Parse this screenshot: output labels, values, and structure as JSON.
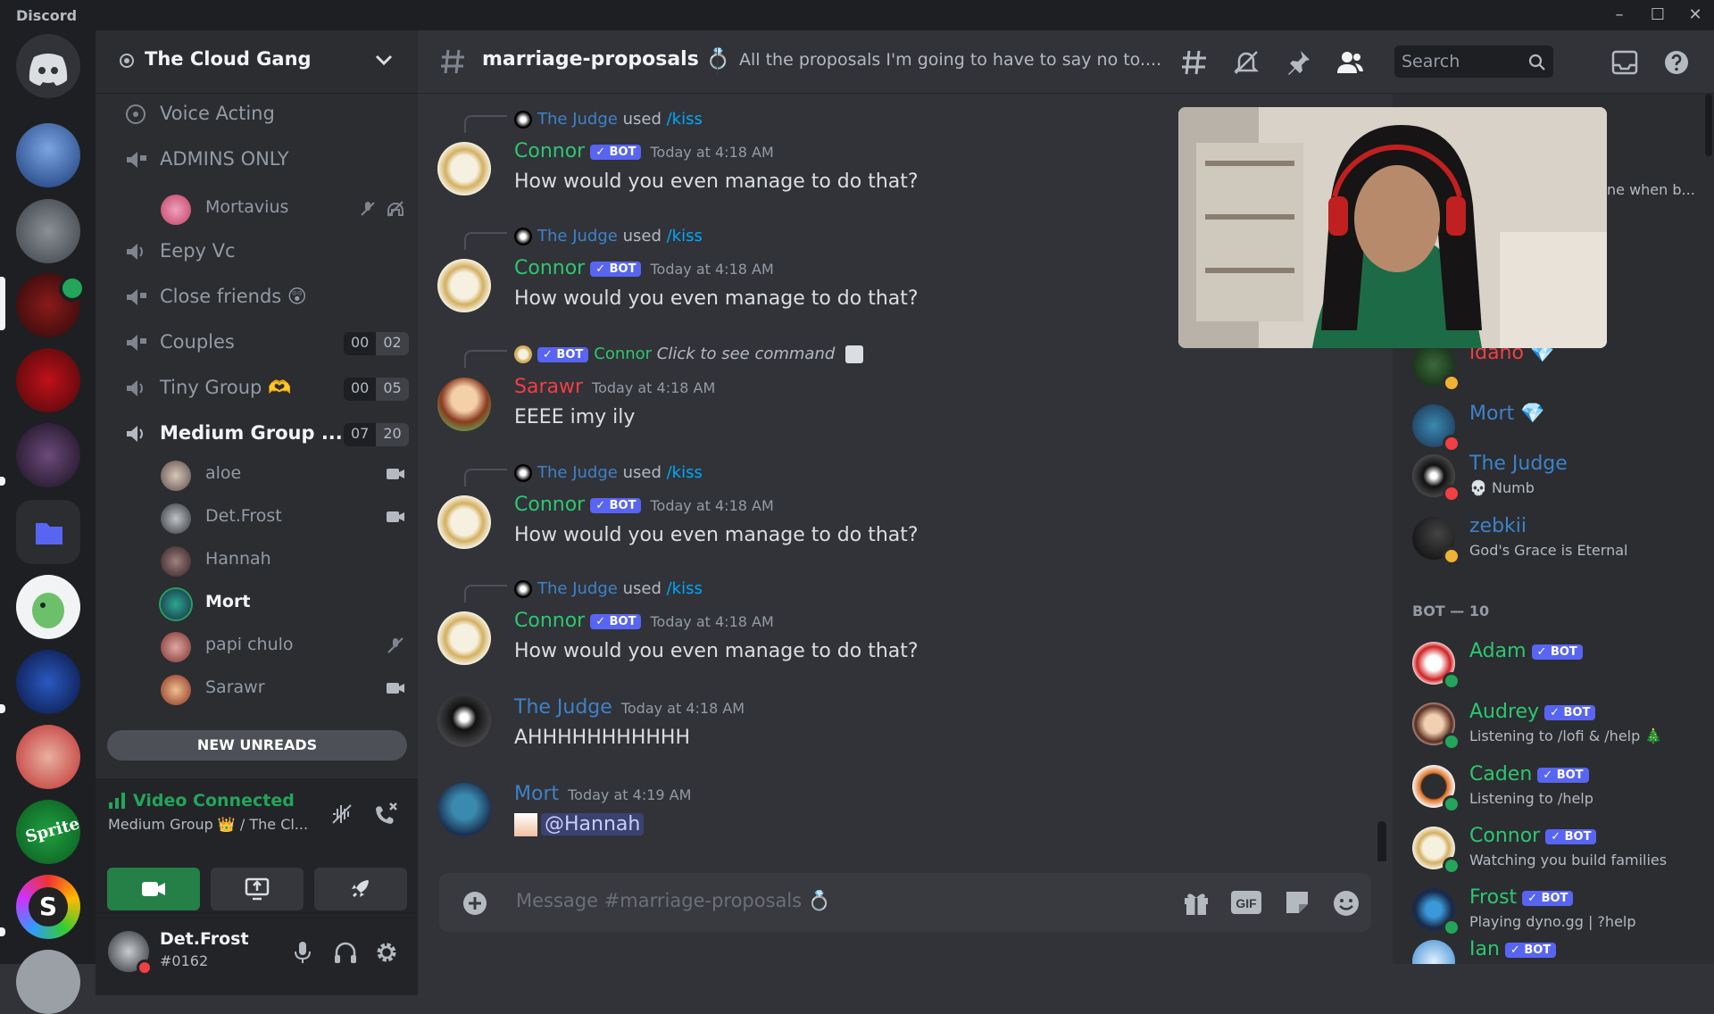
{
  "app": {
    "name": "Discord"
  },
  "colors": {
    "bot_green": "#2dc770",
    "blurple": "#5865f2",
    "judge_blue": "#3e82c9",
    "sarawr_red": "#f23f43",
    "online": "#23a55a",
    "dnd": "#f23f43",
    "idle": "#f0b232"
  },
  "server": {
    "name": "The Cloud Gang"
  },
  "channels": [
    {
      "name": "Voice Acting"
    },
    {
      "name": "ADMINS ONLY"
    },
    {
      "name": "Eepy Vc"
    },
    {
      "name": "Close friends 😲"
    },
    {
      "name": "Couples",
      "count_a": "00",
      "count_b": "02"
    },
    {
      "name": "Tiny Group 🫶",
      "count_a": "00",
      "count_b": "05"
    },
    {
      "name": "Medium Group ...",
      "count_a": "07",
      "count_b": "20"
    }
  ],
  "admins_users": [
    {
      "name": "Mortavius"
    }
  ],
  "voice_users": [
    {
      "name": "aloe"
    },
    {
      "name": "Det.Frost"
    },
    {
      "name": "Hannah"
    },
    {
      "name": "Mort"
    },
    {
      "name": "papi chulo"
    },
    {
      "name": "Sarawr"
    }
  ],
  "new_unreads": "NEW UNREADS",
  "voice": {
    "status": "Video Connected",
    "location": "Medium Group 👑 / The Cl..."
  },
  "user": {
    "name": "Det.Frost",
    "tag": "#0162"
  },
  "channel": {
    "name": "marriage-proposals 💍",
    "topic": "All the proposals I'm going to have to say no to....",
    "placeholder": "Message #marriage-proposals 💍"
  },
  "search": {
    "placeholder": "Search"
  },
  "bot_tag": "✓ BOT",
  "messages": [
    {
      "reply_user": "The Judge",
      "reply_text": "used",
      "command": "/kiss",
      "author": "Connor",
      "time": "Today at 4:18 AM",
      "text": "How would you even manage to do that?"
    },
    {
      "reply_user": "The Judge",
      "reply_text": "used",
      "command": "/kiss",
      "author": "Connor",
      "time": "Today at 4:18 AM",
      "text": "How would you even manage to do that?"
    },
    {
      "reply_user": "Connor",
      "reply_text": "Click to see command",
      "author": "Sarawr",
      "time": "Today at 4:18 AM",
      "text": "EEEE imy ily"
    },
    {
      "reply_user": "The Judge",
      "reply_text": "used",
      "command": "/kiss",
      "author": "Connor",
      "time": "Today at 4:18 AM",
      "text": "How would you even manage to do that?"
    },
    {
      "reply_user": "The Judge",
      "reply_text": "used",
      "command": "/kiss",
      "author": "Connor",
      "time": "Today at 4:18 AM",
      "text": "How would you even manage to do that?"
    },
    {
      "author": "The Judge",
      "time": "Today at 4:18 AM",
      "text": "AHHHHHHHHHHH"
    },
    {
      "author": "Mort",
      "time": "Today at 4:19 AM",
      "text": "@Hannah"
    }
  ],
  "members": {
    "partial_text": "ne when b...",
    "online": [
      {
        "name": "idaho 💎"
      },
      {
        "name": "Mort 💎"
      },
      {
        "name": "The Judge",
        "sub": "💀 Numb"
      },
      {
        "name": "zebkii",
        "sub": "God's Grace is Eternal"
      }
    ],
    "bot_header": "BOT — 10",
    "bots": [
      {
        "name": "Adam"
      },
      {
        "name": "Audrey",
        "sub": "Listening to /lofi & /help 🎄"
      },
      {
        "name": "Caden",
        "sub": "Listening to /help"
      },
      {
        "name": "Connor",
        "sub": "Watching you build families"
      },
      {
        "name": "Frost",
        "sub": "Playing dyno.gg | ?help"
      },
      {
        "name": "Ian"
      }
    ]
  }
}
